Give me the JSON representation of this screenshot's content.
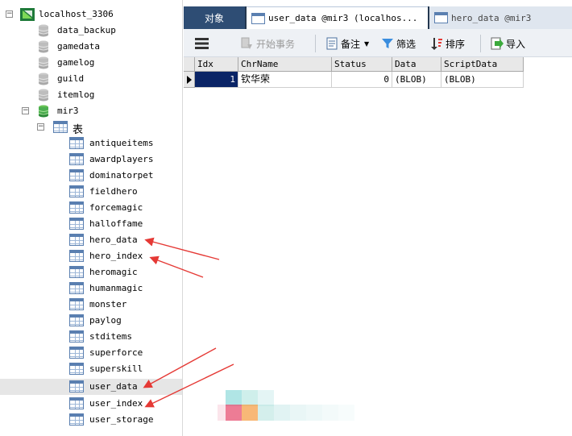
{
  "tree": {
    "connection": "localhost_3306",
    "databases": [
      "data_backup",
      "gamedata",
      "gamelog",
      "guild",
      "itemlog"
    ],
    "open_database": "mir3",
    "tables_folder": "表",
    "tables": [
      "antiqueitems",
      "awardplayers",
      "dominatorpet",
      "fieldhero",
      "forcemagic",
      "halloffame",
      "hero_data",
      "hero_index",
      "heromagic",
      "humanmagic",
      "monster",
      "paylog",
      "stditems",
      "superforce",
      "superskill",
      "user_data",
      "user_index",
      "user_storage"
    ],
    "selected_table": "user_data"
  },
  "tabs": {
    "objects": "对象",
    "active": "user_data @mir3 (localhos...",
    "inactive": "hero_data @mir3"
  },
  "toolbar": {
    "menu_icon": "hamburger-icon",
    "begin_transaction": "开始事务",
    "note": "备注",
    "filter": "筛选",
    "sort": "排序",
    "import": "导入"
  },
  "grid": {
    "columns": [
      "Idx",
      "ChrName",
      "Status",
      "Data",
      "ScriptData"
    ],
    "rows": [
      {
        "Idx": "1",
        "ChrName": "钦华荣",
        "Status": "0",
        "Data": "(BLOB)",
        "ScriptData": "(BLOB)"
      }
    ]
  },
  "colors": {
    "tab_bar": "#23374f",
    "selected_cell": "#0a2466",
    "annotation_arrow": "#e53935"
  }
}
